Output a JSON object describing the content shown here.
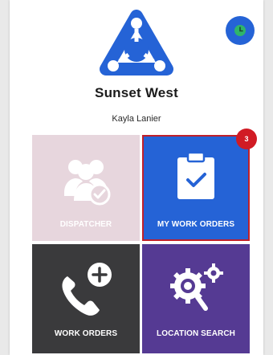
{
  "app": {
    "org_name": "Sunset West",
    "user_name": "Kayla Lanier"
  },
  "status_button": {
    "icon": "clock-icon",
    "color": "#2563d6"
  },
  "logo": {
    "icon": "triangle-network-logo",
    "color": "#2563d6"
  },
  "tiles": [
    {
      "label": "DISPATCHER",
      "icon": "people-check-icon",
      "color": "#e7d6dd",
      "state": "disabled"
    },
    {
      "label": "MY WORK ORDERS",
      "icon": "clipboard-check-icon",
      "color": "#2563d6",
      "badge": "3",
      "state": "selected"
    },
    {
      "label": "WORK ORDERS",
      "icon": "phone-plus-icon",
      "color": "#3a3a3c"
    },
    {
      "label": "LOCATION SEARCH",
      "icon": "gear-search-icon",
      "color": "#553a93"
    }
  ],
  "colors": {
    "badge": "#d11b24",
    "selected_border": "#c0202a"
  }
}
